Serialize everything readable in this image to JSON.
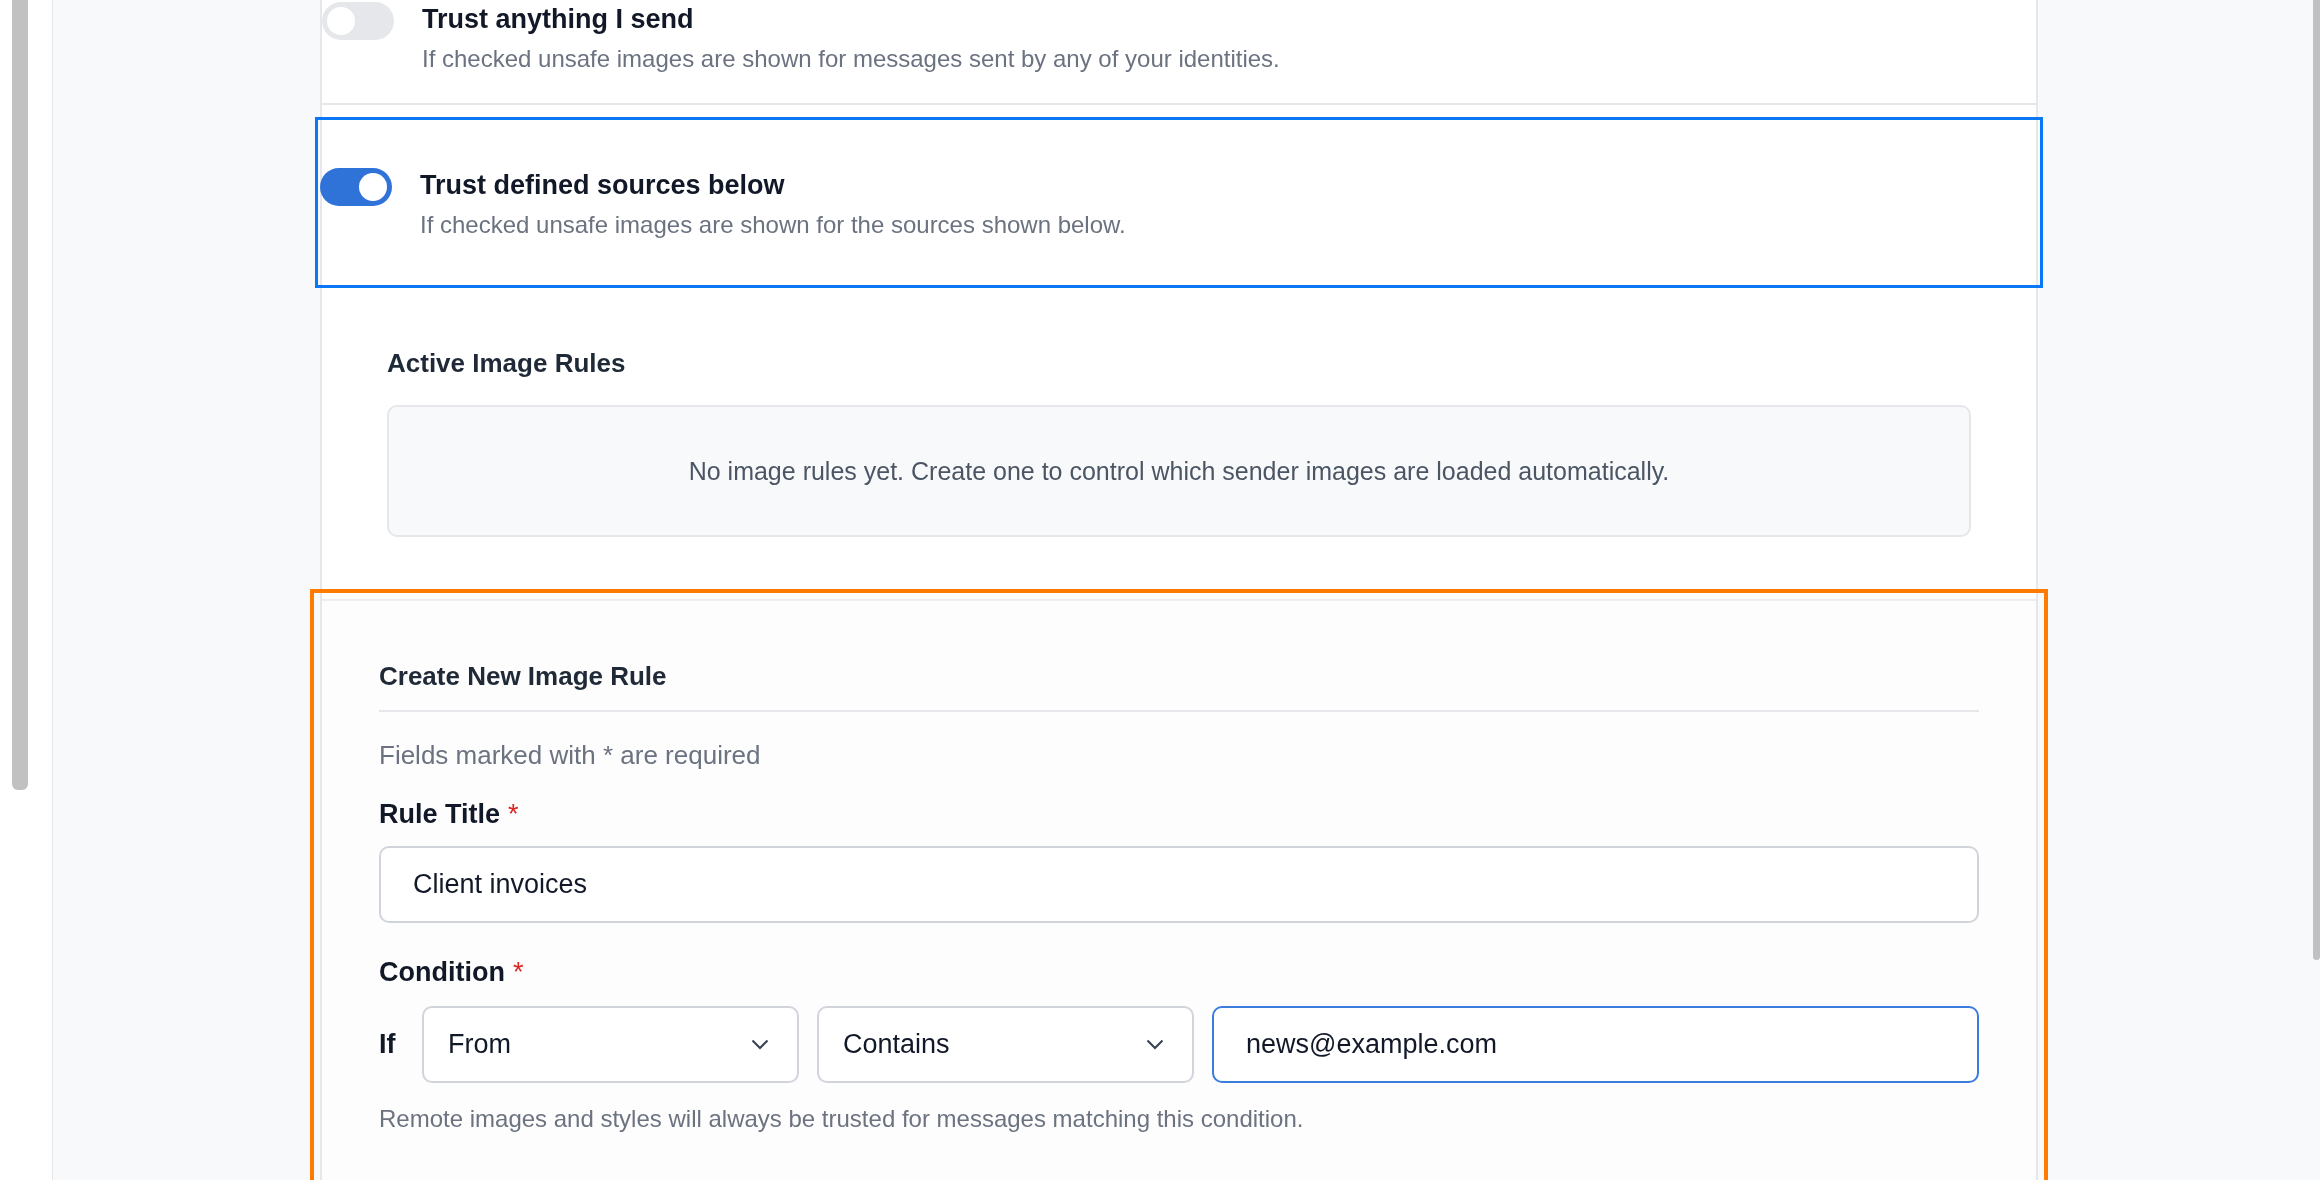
{
  "toggles": [
    {
      "title": "Trust anything I send",
      "description": "If checked unsafe images are shown for messages sent by any of your identities.",
      "on": false,
      "highlighted": false
    },
    {
      "title": "Trust defined sources below",
      "description": "If checked unsafe images are shown for the sources shown below.",
      "on": true,
      "highlighted": true
    }
  ],
  "active_rules": {
    "heading": "Active Image Rules",
    "empty_message": "No image rules yet. Create one to control which sender images are loaded automatically."
  },
  "create_rule": {
    "heading": "Create New Image Rule",
    "required_note": "Fields marked with * are required",
    "rule_title": {
      "label": "Rule Title",
      "required_mark": "*",
      "value": "Client invoices",
      "focused": false
    },
    "condition": {
      "label": "Condition",
      "required_mark": "*",
      "prefix": "If",
      "subject": {
        "value": "From",
        "focused": false
      },
      "operator": {
        "value": "Contains",
        "focused": false
      },
      "value": {
        "value": "news@example.com",
        "focused": true
      },
      "hint": "Remote images and styles will always be trusted for messages matching this condition."
    }
  }
}
